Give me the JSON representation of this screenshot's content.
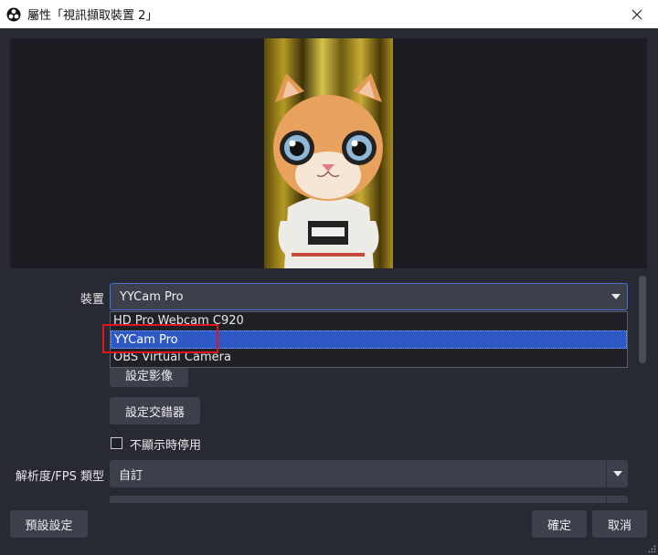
{
  "window": {
    "title": "屬性「視訊擷取裝置 2」"
  },
  "form": {
    "device_label": "裝置",
    "device_value": "YYCam Pro",
    "device_options": [
      "HD Pro Webcam C920",
      "YYCam Pro",
      "OBS Virtual Camera"
    ],
    "selected_option_index": 1,
    "config_video_label": "設定影像",
    "config_crossbar_label": "設定交錯器",
    "deactivate_checkbox_label": "不顯示時停用",
    "deactivate_checked": false,
    "resolution_label": "解析度/FPS 類型",
    "resolution_value": "自訂"
  },
  "footer": {
    "defaults_label": "預設設定",
    "ok_label": "確定",
    "cancel_label": "取消"
  },
  "colors": {
    "accent": "#2e58c4",
    "highlight_box": "#e0141e",
    "panel": "#272a33",
    "control": "#3c404b"
  }
}
